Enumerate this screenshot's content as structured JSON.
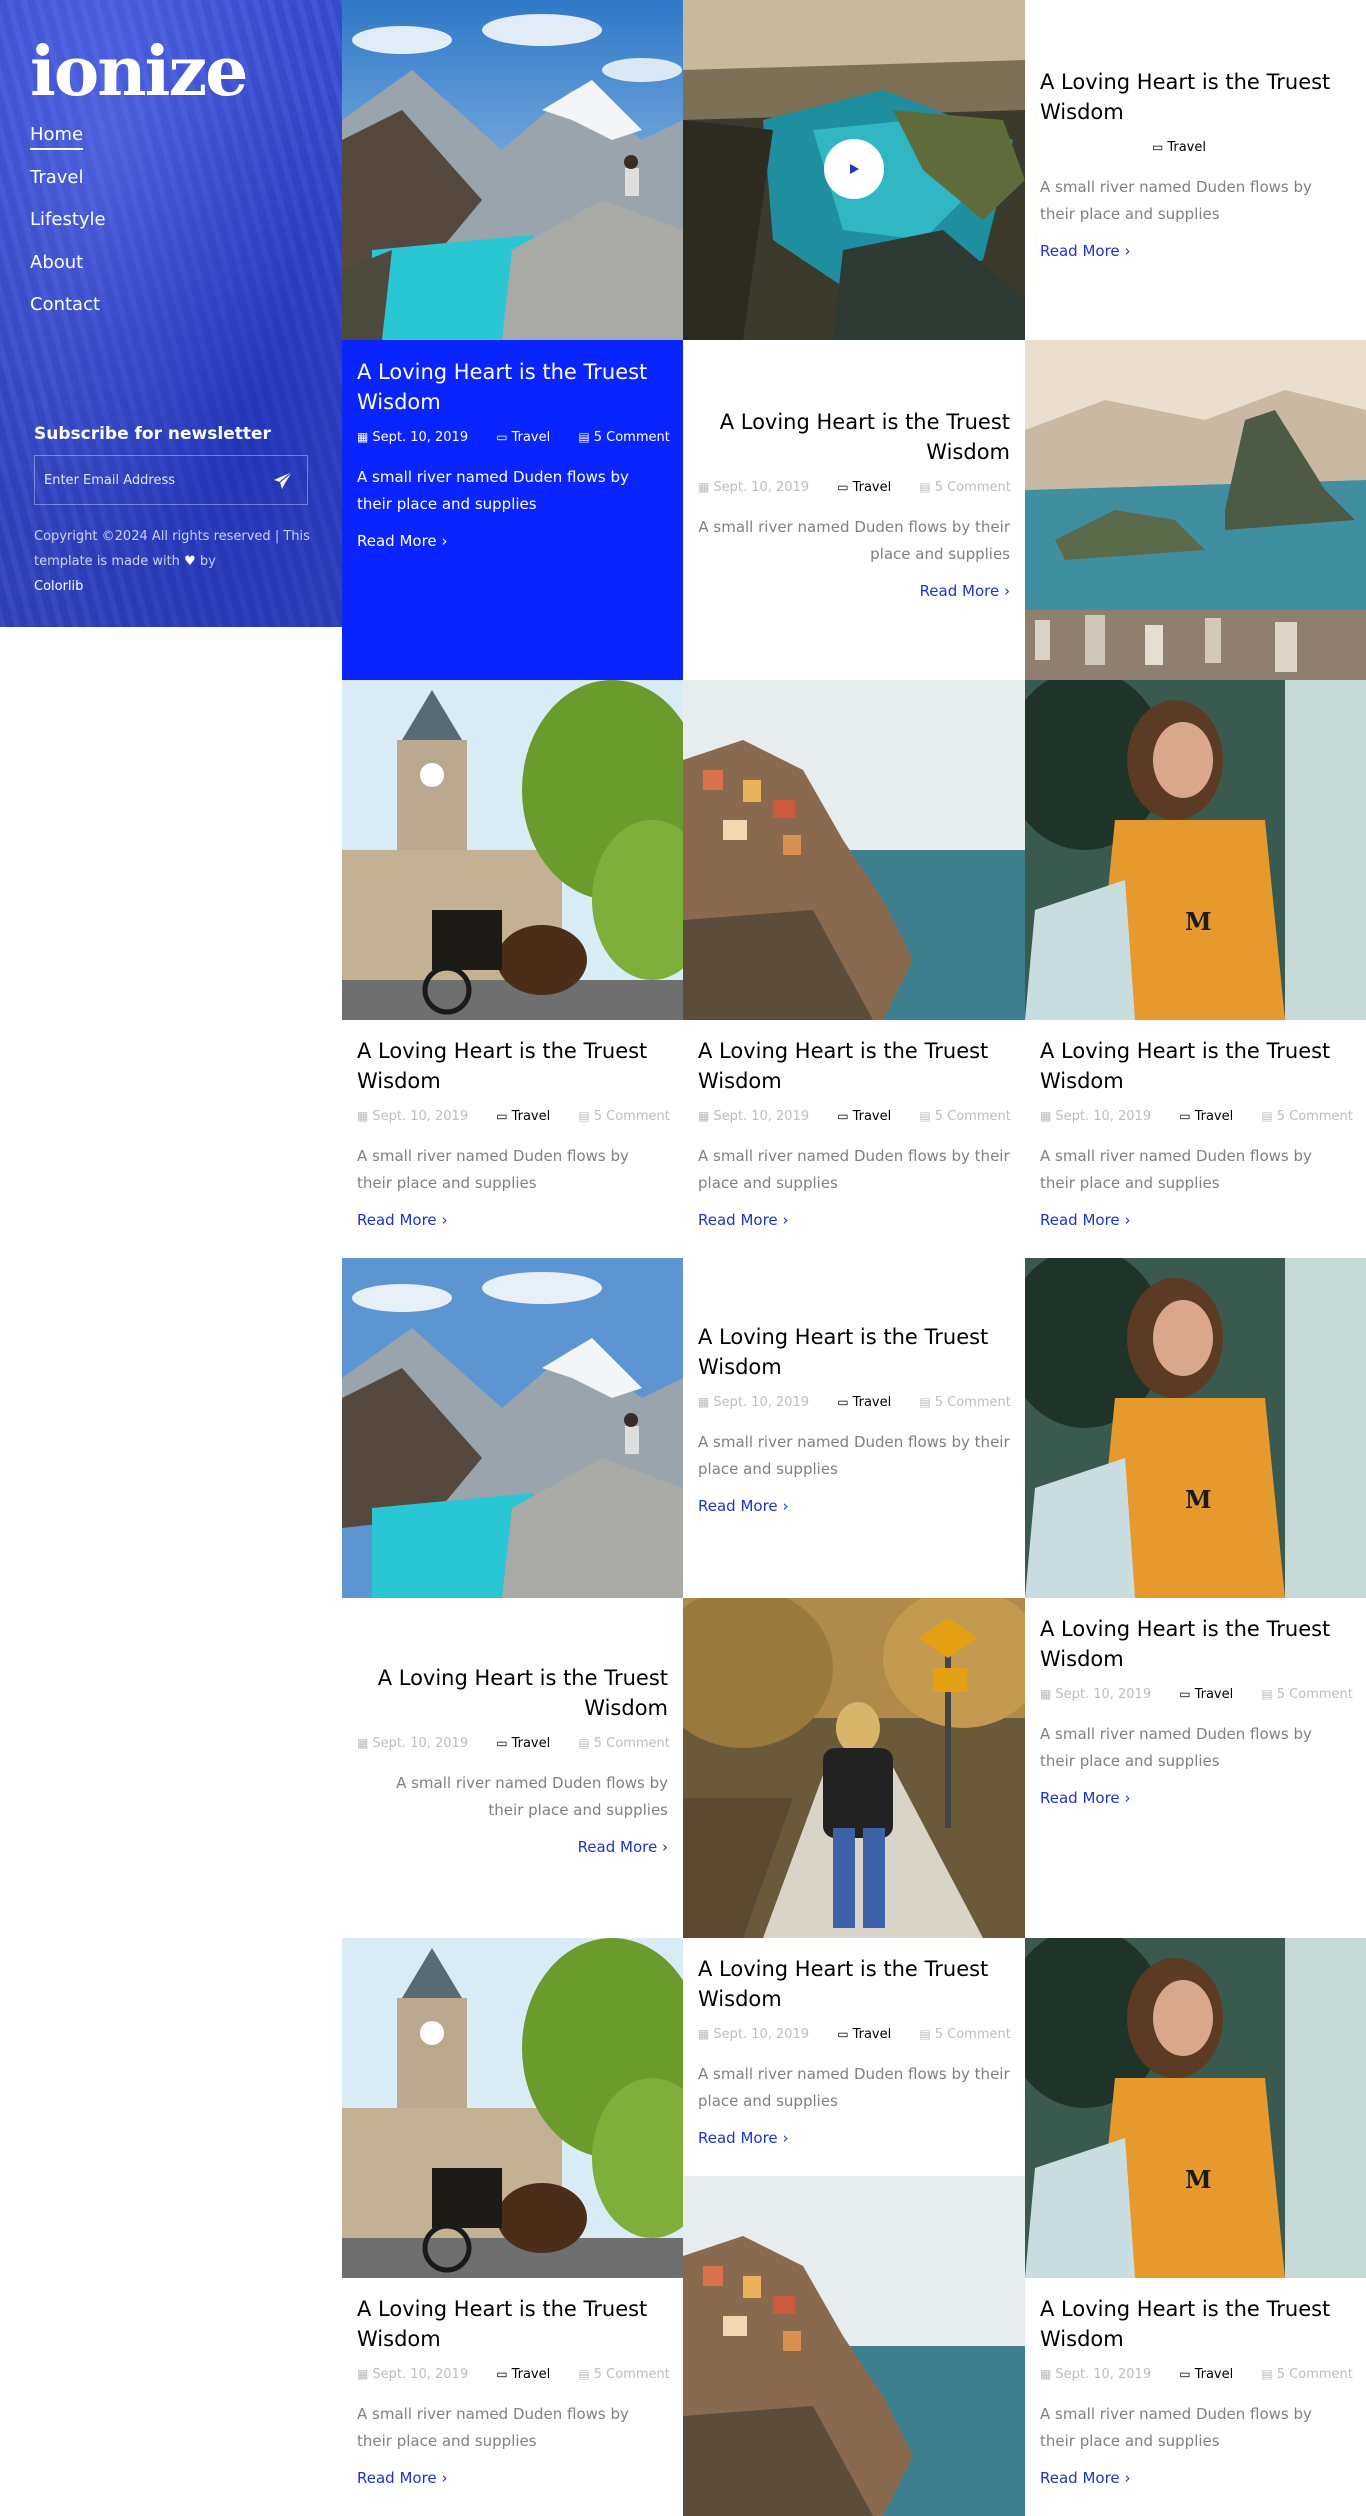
{
  "sidebar": {
    "logo": "ionize",
    "nav": [
      "Home",
      "Travel",
      "Lifestyle",
      "About",
      "Contact"
    ],
    "newsletter_title": "Subscribe for newsletter",
    "email_placeholder": "Enter Email Address",
    "copyright_text": "Copyright ©2024 All rights reserved | This template is made with",
    "copyright_by": "by",
    "copyright_link": "Colorlib"
  },
  "post": {
    "title": "A Loving Heart is the Truest Wisdom",
    "date": "Sept. 10, 2019",
    "category": "Travel",
    "comments": "5 Comment",
    "excerpt": "A small river named Duden flows by their place and supplies",
    "read_more": "Read More"
  },
  "images": {
    "mountain": "mountain lake with person sitting on rock",
    "aerial": "aerial coastline cliff with turquoise water",
    "rio": "coastal city with mountain peak",
    "carriage": "horse carriage in front of clock tower building",
    "cinque": "colorful village on cliff over sea",
    "woman": "woman in orange sweatshirt",
    "walker": "woman walking on autumn forest road"
  },
  "colors": {
    "accent": "#0a24ff",
    "link": "#1e34c9",
    "sidebar": "#3346c8"
  },
  "icons": {
    "calendar": "calendar-icon",
    "folder": "folder-icon",
    "comment": "comment-icon",
    "send": "paper-plane-icon",
    "play": "play-icon",
    "arrow": "chevron-right-icon"
  }
}
